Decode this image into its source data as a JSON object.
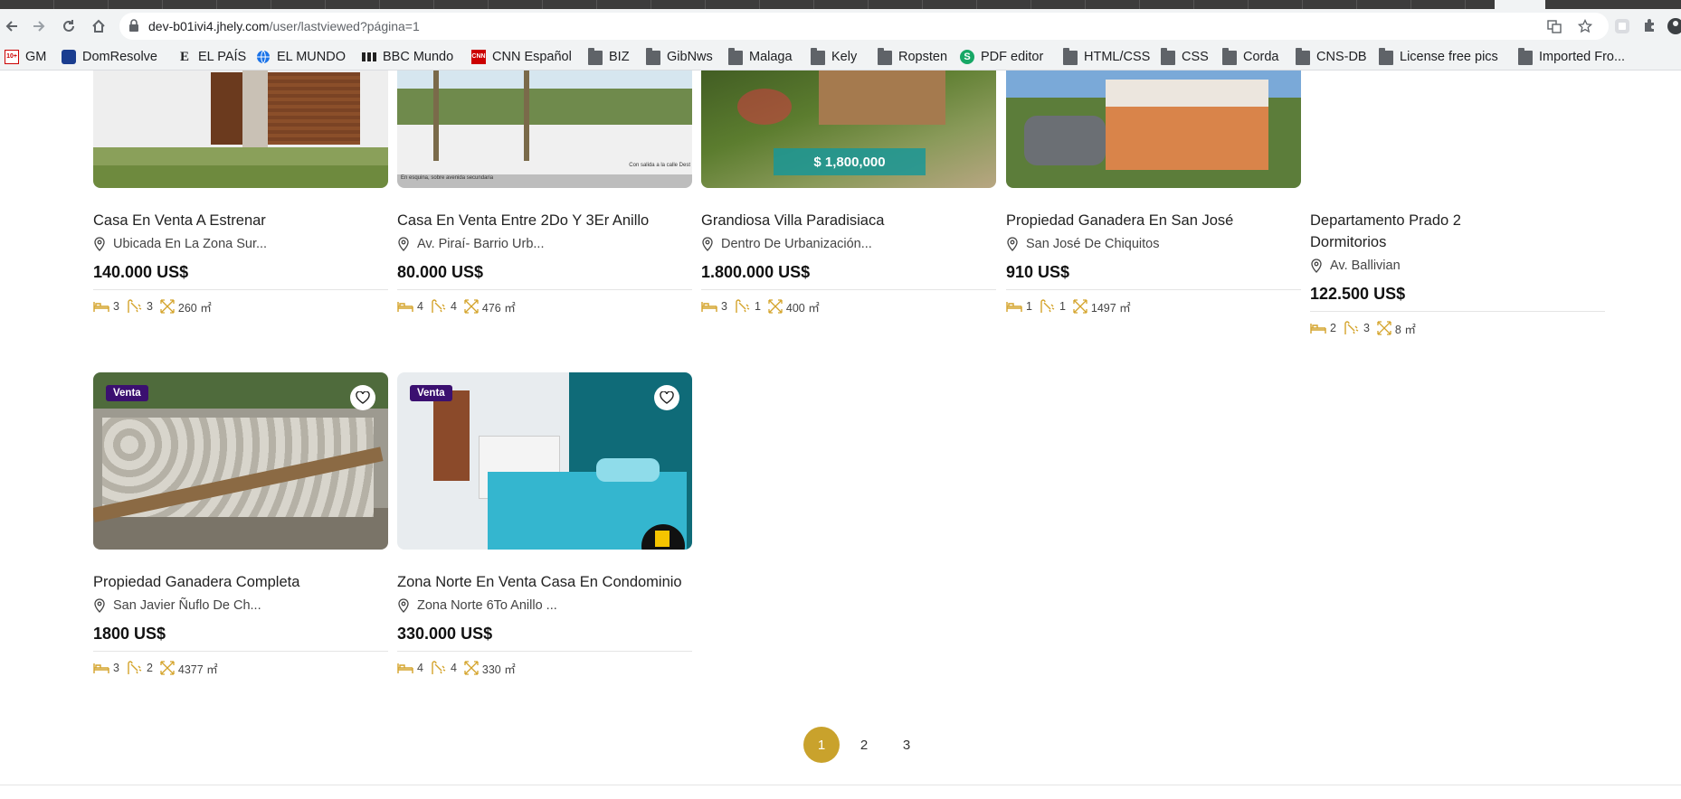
{
  "browser": {
    "url_host": "dev-b01ivi4.jhely.com",
    "url_path": "/user/lastviewed?página=1",
    "bookmarks": [
      {
        "label": "GM",
        "icon": "gm-icon"
      },
      {
        "label": "DomResolve",
        "icon": "domresolve-icon"
      },
      {
        "label": "EL PAÍS",
        "icon": "elpais-icon"
      },
      {
        "label": "EL MUNDO",
        "icon": "globe-icon"
      },
      {
        "label": "BBC Mundo",
        "icon": "bbc-icon"
      },
      {
        "label": "CNN Español",
        "icon": "cnn-icon"
      },
      {
        "label": "BIZ",
        "icon": "folder-icon"
      },
      {
        "label": "GibNws",
        "icon": "folder-icon"
      },
      {
        "label": "Malaga",
        "icon": "folder-icon"
      },
      {
        "label": "Kely",
        "icon": "folder-icon"
      },
      {
        "label": "Ropsten",
        "icon": "folder-icon"
      },
      {
        "label": "PDF editor",
        "icon": "pdf-editor-icon"
      },
      {
        "label": "HTML/CSS",
        "icon": "folder-icon"
      },
      {
        "label": "CSS",
        "icon": "folder-icon"
      },
      {
        "label": "Corda",
        "icon": "folder-icon"
      },
      {
        "label": "CNS-DB",
        "icon": "folder-icon"
      },
      {
        "label": "License free pics",
        "icon": "folder-icon"
      },
      {
        "label": "Imported Fro...",
        "icon": "folder-icon"
      }
    ]
  },
  "colors": {
    "accent_gold": "#c9a22c",
    "badge_purple": "#3b1070"
  },
  "listings": [
    {
      "title": "Casa En Venta A Estrenar",
      "location": "Ubicada En La Zona Sur...",
      "price": "140.000 US$",
      "beds": "3",
      "baths": "3",
      "area": "260 ㎡"
    },
    {
      "title": "Casa En Venta Entre 2Do Y 3Er Anillo",
      "location": "Av. Piraí- Barrio Urb...",
      "price": "80.000 US$",
      "beds": "4",
      "baths": "4",
      "area": "476 ㎡",
      "image_caption": "Con salida a la calle Dest",
      "image_caption2": "En esquina, sobre avenida secundaria"
    },
    {
      "title": "Grandiosa Villa Paradisiaca",
      "location": "Dentro De Urbanización...",
      "price": "1.800.000 US$",
      "beds": "3",
      "baths": "1",
      "area": "400 ㎡",
      "image_overlay_price": "$ 1,800,000"
    },
    {
      "title": "Propiedad Ganadera En San José",
      "location": "San José De Chiquitos",
      "price": "910 US$",
      "beds": "1",
      "baths": "1",
      "area": "1497 ㎡"
    },
    {
      "title": "Departamento Prado 2 Dormitorios",
      "location": "Av. Ballivian",
      "price": "122.500 US$",
      "beds": "2",
      "baths": "3",
      "area": "8 ㎡"
    },
    {
      "title": "Propiedad Ganadera Completa",
      "location": "San Javier Ñuflo De Ch...",
      "price": "1800 US$",
      "beds": "3",
      "baths": "2",
      "area": "4377 ㎡",
      "badge": "Venta"
    },
    {
      "title": "Zona Norte En Venta Casa En Condominio",
      "location": "Zona Norte 6To Anillo ...",
      "price": "330.000 US$",
      "beds": "4",
      "baths": "4",
      "area": "330 ㎡",
      "badge": "Venta"
    }
  ],
  "pagination": {
    "pages": [
      "1",
      "2",
      "3"
    ],
    "current": "1"
  }
}
